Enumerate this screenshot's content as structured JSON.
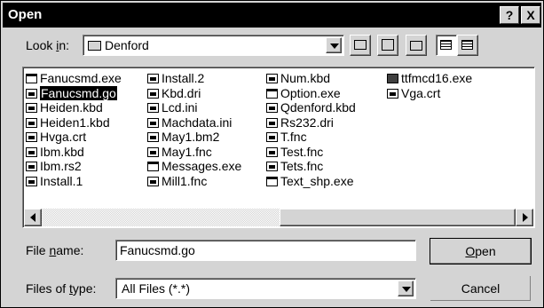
{
  "window": {
    "title": "Open",
    "help_btn": "?",
    "close_btn": "X"
  },
  "lookin": {
    "label_prefix": "Look ",
    "label_accel": "i",
    "label_suffix": "n:",
    "value": "Denford"
  },
  "files": {
    "col1": [
      {
        "name": "Fanucsmd.exe",
        "type": "exe"
      },
      {
        "name": "Fanucsmd.go",
        "type": "doc",
        "selected": true
      },
      {
        "name": "Heiden.kbd",
        "type": "doc"
      },
      {
        "name": "Heiden1.kbd",
        "type": "doc"
      },
      {
        "name": "Hvga.crt",
        "type": "doc"
      },
      {
        "name": "Ibm.kbd",
        "type": "doc"
      },
      {
        "name": "Ibm.rs2",
        "type": "doc"
      },
      {
        "name": "Install.1",
        "type": "doc"
      }
    ],
    "col2": [
      {
        "name": "Install.2",
        "type": "doc"
      },
      {
        "name": "Kbd.dri",
        "type": "doc"
      },
      {
        "name": "Lcd.ini",
        "type": "doc"
      },
      {
        "name": "Machdata.ini",
        "type": "doc"
      },
      {
        "name": "May1.bm2",
        "type": "doc"
      },
      {
        "name": "May1.fnc",
        "type": "doc"
      },
      {
        "name": "Messages.exe",
        "type": "exe"
      },
      {
        "name": "Mill1.fnc",
        "type": "doc"
      }
    ],
    "col3": [
      {
        "name": "Num.kbd",
        "type": "doc"
      },
      {
        "name": "Option.exe",
        "type": "exe"
      },
      {
        "name": "Qdenford.kbd",
        "type": "doc"
      },
      {
        "name": "Rs232.dri",
        "type": "doc"
      },
      {
        "name": "T.fnc",
        "type": "doc"
      },
      {
        "name": "Test.fnc",
        "type": "doc"
      },
      {
        "name": "Tets.fnc",
        "type": "doc"
      },
      {
        "name": "Text_shp.exe",
        "type": "exe"
      }
    ],
    "col4": [
      {
        "name": "ttfmcd16.exe",
        "type": "dark"
      },
      {
        "name": "Vga.crt",
        "type": "doc"
      }
    ]
  },
  "filename": {
    "label_prefix": "File ",
    "label_accel": "n",
    "label_suffix": "ame:",
    "value": "Fanucsmd.go"
  },
  "filetype": {
    "label_prefix": "Files of ",
    "label_accel": "t",
    "label_suffix": "ype:",
    "value": "All Files (*.*)"
  },
  "buttons": {
    "open_accel": "O",
    "open_rest": "pen",
    "cancel": "Cancel"
  }
}
